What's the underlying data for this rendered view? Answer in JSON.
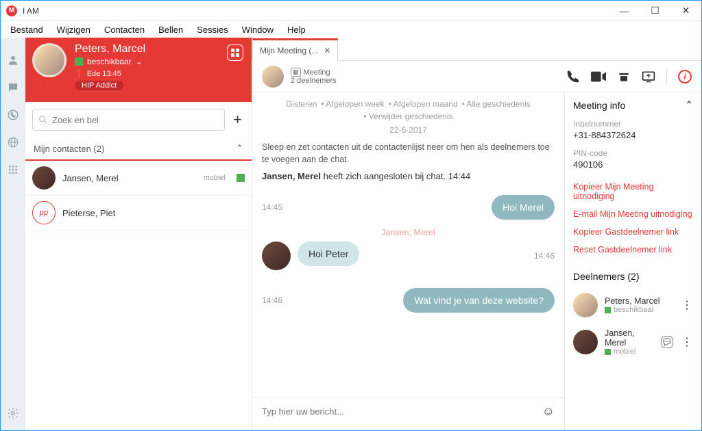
{
  "app_title": "I AM",
  "menubar": [
    "Bestand",
    "Wijzigen",
    "Contacten",
    "Bellen",
    "Sessies",
    "Window",
    "Help"
  ],
  "user": {
    "name": "Peters, Marcel",
    "status": "beschikbaar",
    "location": "Ede  13:45",
    "badge": "HIP Addict"
  },
  "search_placeholder": "Zoek en bel",
  "contacts_group": "Mijn contacten (2)",
  "contacts": [
    {
      "name": "Jansen, Merel",
      "status": "mobiel",
      "avatar": "photo"
    },
    {
      "name": "Pieterse, Piet",
      "status": "",
      "avatar": "pp",
      "initials": "pp"
    }
  ],
  "tab_label": "Mijn Meeting (...",
  "meeting_header": {
    "title": "Meeting",
    "subtitle": "2 deelnemers"
  },
  "history_links": [
    "Gisteren",
    "Afgelopen week",
    "Afgelopen maand",
    "Alle geschiedenis"
  ],
  "delete_history": "Verwijder geschiedenis",
  "chat_date": "22-6-2017",
  "instruction": "Sleep en zet contacten uit de contactenlijst neer om hen als deelnemers toe te voegen aan de chat.",
  "join_event": {
    "name": "Jansen, Merel",
    "text": " heeft zich aangesloten bij chat. 14:44"
  },
  "messages": {
    "m1_time": "14:45",
    "m1_text": "Hoi Merel",
    "sender2": "Jansen, Merel",
    "m2_text": "Hoi Peter",
    "m2_time": "14:46",
    "m3_time": "14:46",
    "m3_text": "Wat vind je van deze website?"
  },
  "input_placeholder": "Typ hier uw bericht...",
  "info_panel": {
    "title": "Meeting info",
    "dial_label": "Inbelnummer",
    "dial_value": "+31-884372624",
    "pin_label": "PIN-code",
    "pin_value": "490106",
    "links": [
      "Kopieer  Mijn Meeting uitnodiging",
      "E-mail Mijn Meeting uitnodiging",
      "Kopieer Gastdeelnemer link",
      "Reset Gastdeelnemer link"
    ],
    "participants_title": "Deelnemers (2)",
    "participants": [
      {
        "name": "Peters, Marcel",
        "status": "beschikbaar"
      },
      {
        "name": "Jansen, Merel",
        "status": "mobiel"
      }
    ]
  }
}
